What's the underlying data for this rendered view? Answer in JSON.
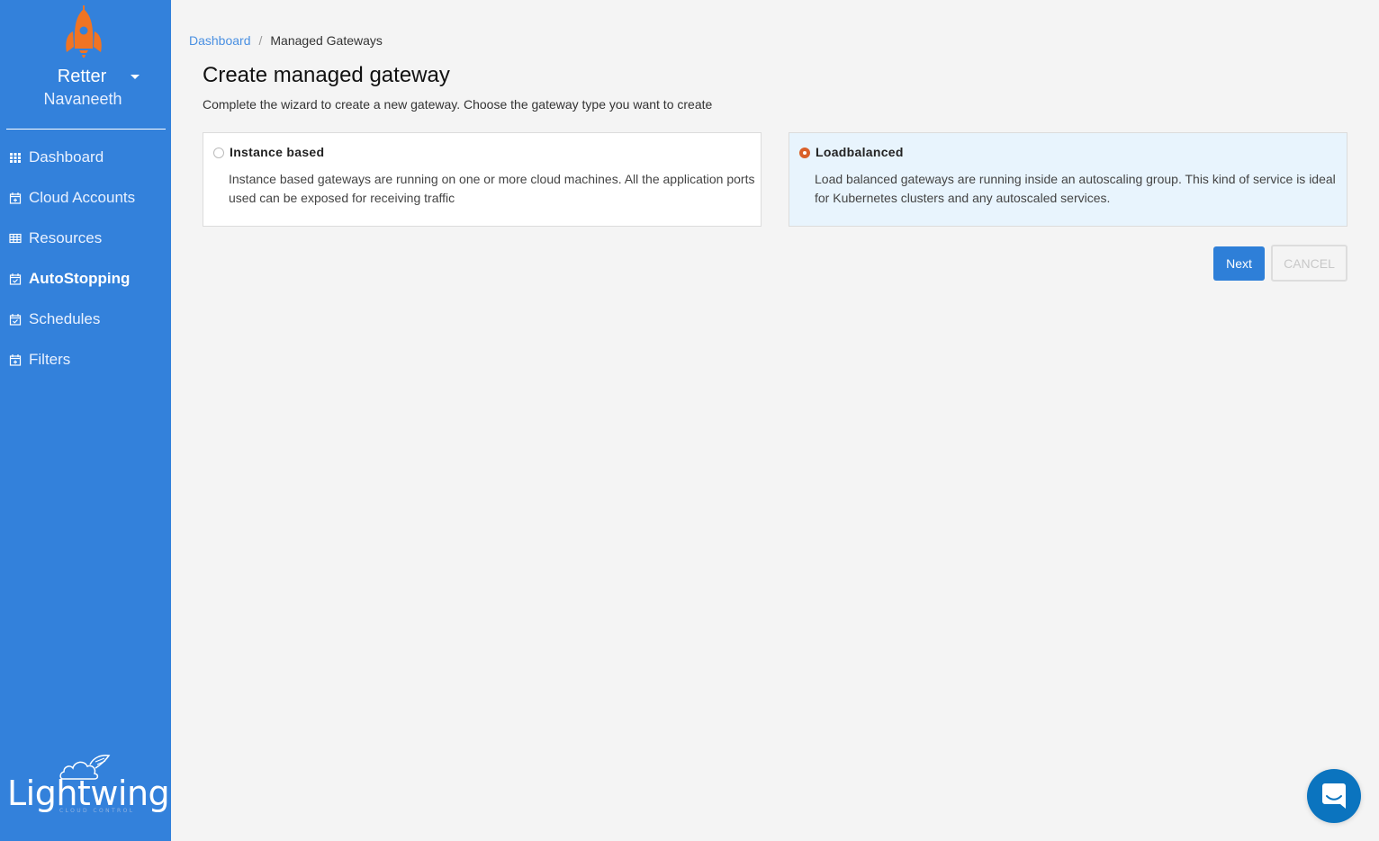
{
  "sidebar": {
    "org_name": "Retter",
    "user_name": "Navaneeth",
    "items": [
      {
        "label": "Dashboard",
        "icon": "grid-icon",
        "active": false
      },
      {
        "label": "Cloud Accounts",
        "icon": "calendar-plus-icon",
        "active": false
      },
      {
        "label": "Resources",
        "icon": "table-icon",
        "active": false
      },
      {
        "label": "AutoStopping",
        "icon": "calendar-check-icon",
        "active": true
      },
      {
        "label": "Schedules",
        "icon": "calendar-check-icon",
        "active": false
      },
      {
        "label": "Filters",
        "icon": "calendar-plus-icon",
        "active": false
      }
    ],
    "footer_logo": {
      "name": "Lightwing",
      "tagline": "CLOUD CONTROL"
    }
  },
  "breadcrumb": {
    "items": [
      {
        "label": "Dashboard",
        "link": true
      },
      {
        "label": "Managed Gateways",
        "link": false
      }
    ],
    "separator": "/"
  },
  "page": {
    "title": "Create managed gateway",
    "subtitle": "Complete the wizard to create a new gateway. Choose the gateway type you want to create"
  },
  "options": [
    {
      "title": "Instance based",
      "description": "Instance based gateways are running on one or more cloud machines. All the application ports used can be exposed for receiving traffic",
      "selected": false
    },
    {
      "title": "Loadbalanced",
      "description": "Load balanced gateways are running inside an autoscaling group. This kind of service is ideal for Kubernetes clusters and any autoscaled services.",
      "selected": true
    }
  ],
  "actions": {
    "next_label": "Next",
    "cancel_label": "CANCEL"
  },
  "colors": {
    "sidebar_bg": "#3381db",
    "primary": "#2e7fd8",
    "selected_radio": "#d9602a",
    "selected_card_bg": "#e8f4fd",
    "brand_orange": "#f07423",
    "chat_launcher": "#0b74bf"
  }
}
